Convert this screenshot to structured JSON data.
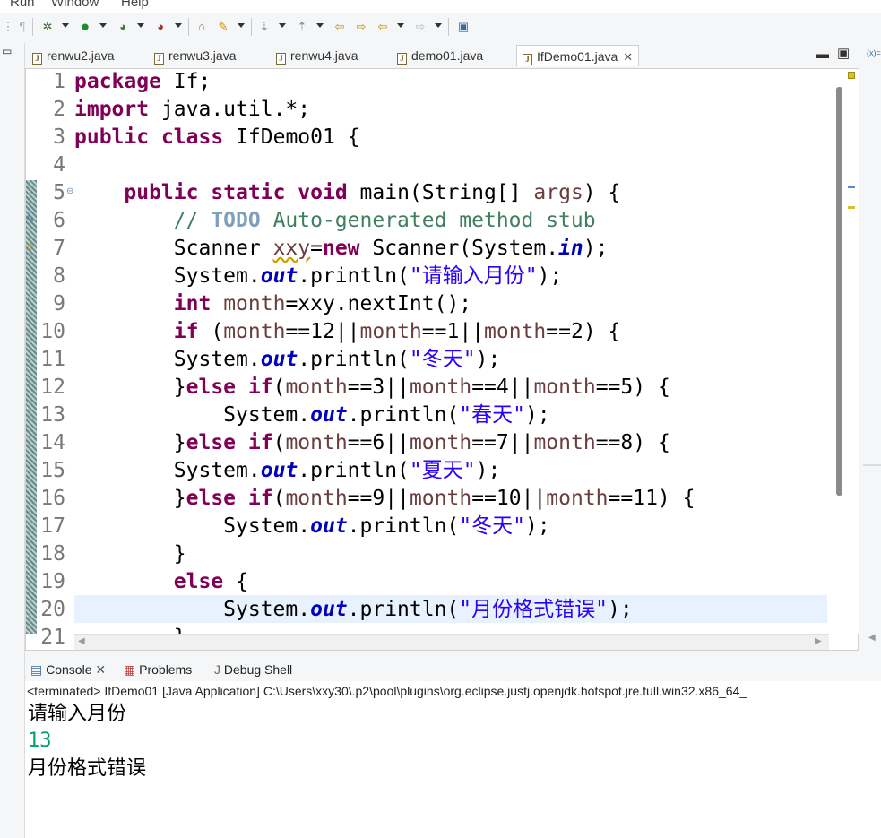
{
  "menu": {
    "items": [
      "Run",
      "Window",
      "Help"
    ]
  },
  "toolbar": {
    "icons": [
      "debug-icon",
      "run-icon",
      "run-coverage-icon",
      "external-tools-icon",
      "open-type-icon",
      "search-icon",
      "next-annotation-icon",
      "prev-annotation-icon",
      "back-icon",
      "forward-icon",
      "pin-editor-icon"
    ]
  },
  "editor": {
    "tabs": [
      {
        "label": "renwu2.java"
      },
      {
        "label": "renwu3.java"
      },
      {
        "label": "renwu4.java"
      },
      {
        "label": "demo01.java"
      },
      {
        "label": "IfDemo01.java"
      }
    ],
    "line_numbers": [
      "1",
      "2",
      "3",
      "4",
      "5",
      "6",
      "7",
      "8",
      "9",
      "10",
      "11",
      "12",
      "13",
      "14",
      "15",
      "16",
      "17",
      "18",
      "19",
      "20",
      "21"
    ],
    "current_line": "20"
  },
  "console": {
    "tabs": [
      {
        "label": "Console"
      },
      {
        "label": "Problems"
      },
      {
        "label": "Debug Shell"
      }
    ],
    "status": "<terminated> IfDemo01 [Java Application] C:\\Users\\xxy30\\.p2\\pool\\plugins\\org.eclipse.justj.openjdk.hotspot.jre.full.win32.x86_64_",
    "output": [
      {
        "text": "请输入月份",
        "kind": "stdout"
      },
      {
        "text": "13",
        "kind": "stdin"
      },
      {
        "text": "月份格式错误",
        "kind": "stdout"
      }
    ]
  },
  "right_panel": {
    "label": "(x)="
  },
  "colors": {
    "keyword": "#7f0055",
    "comment": "#3f7f5f",
    "string": "#2a00ff",
    "field": "#0000c0",
    "variable": "#6a3e3e",
    "stdin": "#00a070",
    "current_line_bg": "#e8f2fe"
  },
  "code": {
    "l1": {
      "kw": "package",
      "t": " If;"
    },
    "l2": {
      "kw": "import",
      "t": " java.util.*;"
    },
    "l3": {
      "kw1": "public",
      "kw2": "class",
      "t": " IfDemo01 {"
    },
    "l5": {
      "indent": "    ",
      "kw1": "public",
      "kw2": "static",
      "kw3": "void",
      "t1": " main(String[] ",
      "v": "args",
      "t2": ") {"
    },
    "l6": {
      "indent": "        ",
      "c1": "// ",
      "todo": "TODO",
      "c2": " Auto-generated method stub"
    },
    "l7": {
      "indent": "        ",
      "t1": "Scanner ",
      "v": "xxy",
      "t2": "=",
      "kw": "new",
      "t3": " Scanner(System.",
      "f": "in",
      "t4": ");"
    },
    "l8": {
      "indent": "        ",
      "t1": "System.",
      "f": "out",
      "t2": ".println(",
      "s": "\"请输入月份\"",
      "t3": ");"
    },
    "l9": {
      "indent": "        ",
      "kw": "int",
      "t1": " ",
      "v1": "month",
      "t2": "=xxy.nextInt();"
    },
    "l10": {
      "indent": "        ",
      "kw": "if",
      "t1": " (",
      "v1": "month",
      "t2": "==12||",
      "v2": "month",
      "t3": "==1||",
      "v3": "month",
      "t4": "==2) {"
    },
    "l11": {
      "indent": "        ",
      "t1": "System.",
      "f": "out",
      "t2": ".println(",
      "s": "\"冬天\"",
      "t3": ");"
    },
    "l12": {
      "indent": "        ",
      "t0": "}",
      "kw1": "else",
      "t1": " ",
      "kw2": "if",
      "t2": "(",
      "v1": "month",
      "t3": "==3||",
      "v2": "month",
      "t4": "==4||",
      "v3": "month",
      "t5": "==5) {"
    },
    "l13": {
      "indent": "            ",
      "t1": "System.",
      "f": "out",
      "t2": ".println(",
      "s": "\"春天\"",
      "t3": ");"
    },
    "l14": {
      "indent": "        ",
      "t0": "}",
      "kw1": "else",
      "t1": " ",
      "kw2": "if",
      "t2": "(",
      "v1": "month",
      "t3": "==6||",
      "v2": "month",
      "t4": "==7||",
      "v3": "month",
      "t5": "==8) {"
    },
    "l15": {
      "indent": "        ",
      "t1": "System.",
      "f": "out",
      "t2": ".println(",
      "s": "\"夏天\"",
      "t3": ");"
    },
    "l16": {
      "indent": "        ",
      "t0": "}",
      "kw1": "else",
      "t1": " ",
      "kw2": "if",
      "t2": "(",
      "v1": "month",
      "t3": "==9||",
      "v2": "month",
      "t4": "==10||",
      "v3": "month",
      "t5": "==11) {"
    },
    "l17": {
      "indent": "            ",
      "t1": "System.",
      "f": "out",
      "t2": ".println(",
      "s": "\"冬天\"",
      "t3": ");"
    },
    "l18": {
      "indent": "        ",
      "t": "}"
    },
    "l19": {
      "indent": "        ",
      "kw": "else",
      "t": " {"
    },
    "l20": {
      "indent": "            ",
      "t1": "System.",
      "f": "out",
      "t2": ".println(",
      "s": "\"月份格式错误\"",
      "t3": ");"
    },
    "l21": {
      "indent": "        ",
      "t": "}"
    }
  }
}
